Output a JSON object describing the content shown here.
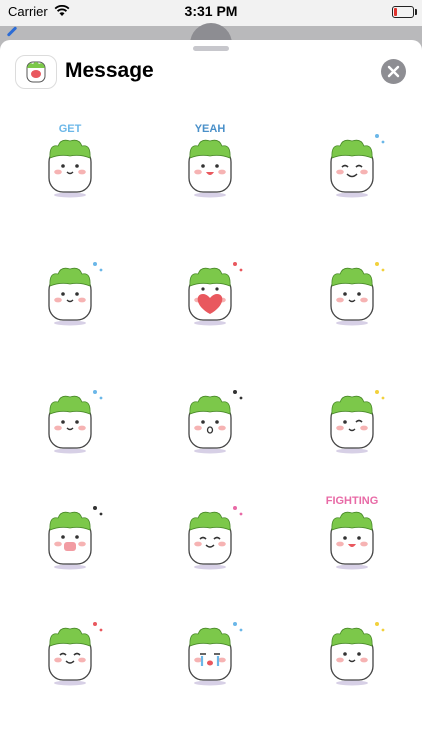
{
  "status_bar": {
    "carrier": "Carrier",
    "time": "3:31 PM",
    "battery_level": 0.15,
    "battery_color": "#e0322d"
  },
  "header": {
    "title": "Message",
    "app_icon": "sticker-app-icon",
    "close_icon": "close-icon"
  },
  "colors": {
    "leaf_green": "#7cc84a",
    "blush": "#f6b3b3",
    "heart": "#e9585e",
    "accent_blue": "#6bb7e8",
    "accent_pink": "#e86aa6",
    "accent_yellow": "#f2d13c",
    "accent_purple": "#a98be6"
  },
  "stickers": [
    {
      "name": "sticker-get",
      "caption": "GET",
      "caption_color": "#6bb7e8",
      "expr": "smile"
    },
    {
      "name": "sticker-yeah",
      "caption": "YEAH",
      "caption_color": "#4a90c9",
      "expr": "cheer"
    },
    {
      "name": "sticker-giggle",
      "caption": "",
      "caption_color": "#6bb7e8",
      "expr": "grin"
    },
    {
      "name": "sticker-wave",
      "caption": "",
      "caption_color": "#6bb7e8",
      "expr": "smile"
    },
    {
      "name": "sticker-heart",
      "caption": "",
      "caption_color": "#e9585e",
      "expr": "heart"
    },
    {
      "name": "sticker-sparkle",
      "caption": "",
      "caption_color": "#f2d13c",
      "expr": "smile"
    },
    {
      "name": "sticker-sing",
      "caption": "",
      "caption_color": "#6bb7e8",
      "expr": "smile"
    },
    {
      "name": "sticker-shock",
      "caption": "",
      "caption_color": "#333333",
      "expr": "shock"
    },
    {
      "name": "sticker-angel",
      "caption": "",
      "caption_color": "#f2d13c",
      "expr": "wink"
    },
    {
      "name": "sticker-eat",
      "caption": "",
      "caption_color": "#333333",
      "expr": "eat"
    },
    {
      "name": "sticker-love",
      "caption": "",
      "caption_color": "#e86aa6",
      "expr": "happy"
    },
    {
      "name": "sticker-fighting",
      "caption": "FIGHTING",
      "caption_color": "#e86aa6",
      "expr": "cheer"
    },
    {
      "name": "sticker-hearts",
      "caption": "",
      "caption_color": "#e9585e",
      "expr": "happy"
    },
    {
      "name": "sticker-cry",
      "caption": "",
      "caption_color": "#6bb7e8",
      "expr": "cry"
    },
    {
      "name": "sticker-crown",
      "caption": "",
      "caption_color": "#f2d13c",
      "expr": "smile"
    }
  ]
}
